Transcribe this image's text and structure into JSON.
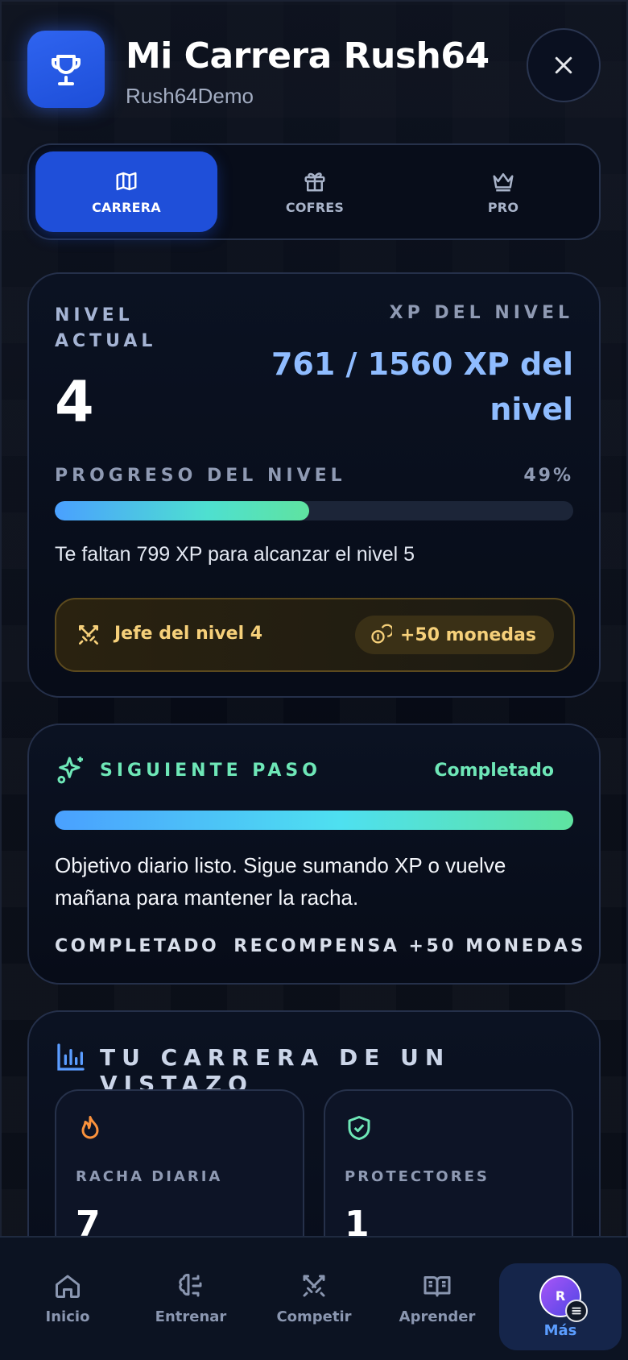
{
  "header": {
    "title": "Mi Carrera Rush64",
    "subtitle": "Rush64Demo",
    "badge_icon": "trophy-icon",
    "close_icon": "close-icon"
  },
  "tabs": [
    {
      "label": "CARRERA",
      "icon": "map-icon",
      "active": true
    },
    {
      "label": "COFRES",
      "icon": "gift-icon",
      "active": false
    },
    {
      "label": "PRO",
      "icon": "crown-icon",
      "active": false
    }
  ],
  "level_card": {
    "level_label": "NIVEL ACTUAL",
    "level_value": "4",
    "xp_label": "XP DEL NIVEL",
    "xp_value": "761 / 1560 XP del nivel",
    "progress_label": "PROGRESO DEL NIVEL",
    "progress_percent_text": "49%",
    "progress_fraction": 0.49,
    "remaining_text": "Te faltan 799 XP para alcanzar el nivel 5",
    "boss_label": "Jefe del nivel 4",
    "boss_reward": "+50 monedas"
  },
  "next_step": {
    "label": "SIGUIENTE PASO",
    "status": "Completado",
    "progress_fraction": 1.0,
    "description": "Objetivo diario listo. Sigue sumando XP o vuelve mañana para mantener la racha.",
    "footer_status": "COMPLETADO",
    "footer_reward": "RECOMPENSA +50 MONEDAS"
  },
  "glance": {
    "label": "TU CARRERA DE UN VISTAZO",
    "stats": [
      {
        "label": "RACHA DIARIA",
        "value": "7",
        "icon": "flame-icon"
      },
      {
        "label": "PROTECTORES",
        "value": "1",
        "icon": "shield-check-icon"
      }
    ]
  },
  "bottom_nav": [
    {
      "label": "Inicio",
      "icon": "home-icon"
    },
    {
      "label": "Entrenar",
      "icon": "brain-icon"
    },
    {
      "label": "Competir",
      "icon": "swords-icon"
    },
    {
      "label": "Aprender",
      "icon": "book-icon"
    },
    {
      "label": "Más",
      "icon": "avatar",
      "avatar_initial": "R",
      "active": true
    }
  ],
  "colors": {
    "accent_blue": "#1f4fd9",
    "xp_blue": "#8fbcff",
    "success_green": "#6ee7b7",
    "gold": "#f6d07a"
  }
}
